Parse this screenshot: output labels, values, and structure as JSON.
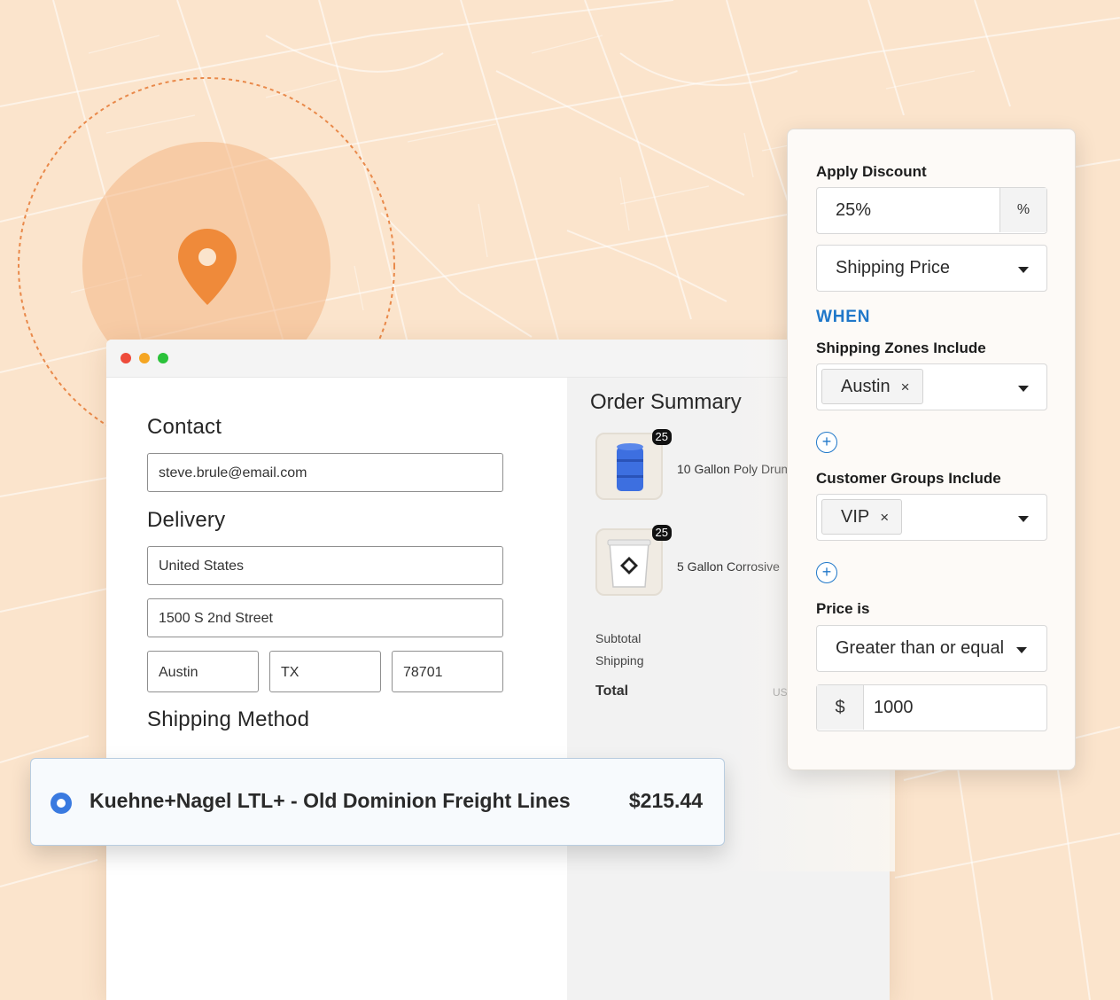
{
  "window": {
    "controls": [
      "close",
      "minimize",
      "maximize"
    ]
  },
  "checkout": {
    "contact_title": "Contact",
    "email": "steve.brule@email.com",
    "delivery_title": "Delivery",
    "country": "United States",
    "address": "1500 S 2nd Street",
    "city": "Austin",
    "state": "TX",
    "zip": "78701",
    "shipping_method_title": "Shipping Method"
  },
  "order_summary": {
    "title": "Order Summary",
    "items": [
      {
        "name": "10 Gallon Poly Drum",
        "quantity": "25",
        "icon": "blue-drum-icon"
      },
      {
        "name": "5 Gallon Corrosive",
        "quantity": "25",
        "icon": "white-pail-icon"
      }
    ],
    "subtotal_label": "Subtotal",
    "shipping_label": "Shipping",
    "total_label": "Total",
    "currency_label": "US"
  },
  "shipping_option": {
    "name": "Kuehne+Nagel LTL+ - Old Dominion Freight Lines",
    "price": "$215.44",
    "selected": true
  },
  "discount_rule": {
    "apply_label": "Apply Discount",
    "amount": "25%",
    "unit_toggle": "%",
    "target": "Shipping Price",
    "when_label": "WHEN",
    "zones_label": "Shipping Zones Include",
    "zone_chip": "Austin",
    "groups_label": "Customer Groups Include",
    "group_chip": "VIP",
    "price_label": "Price is",
    "comparator": "Greater than or equal",
    "currency_symbol": "$",
    "price_value": "1000",
    "chip_remove": "×",
    "add_symbol": "+"
  },
  "colors": {
    "map_background": "#fbe4cc",
    "pin": "#ef8a3a",
    "accent_blue": "#1f77c9",
    "radio_blue": "#3a7ae0"
  }
}
